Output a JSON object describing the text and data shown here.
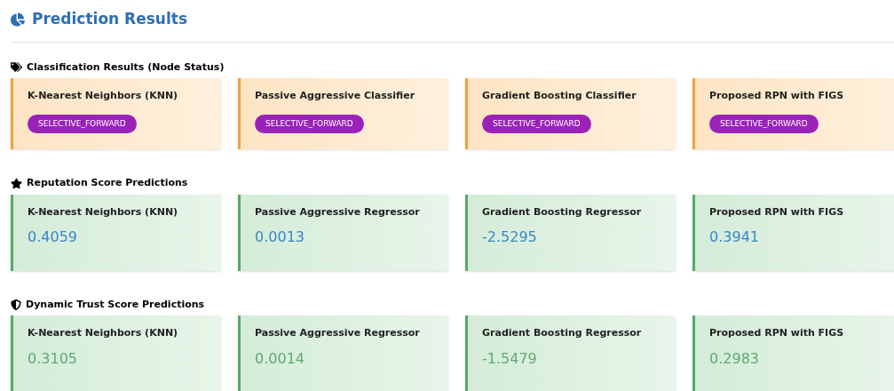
{
  "title": "Prediction Results",
  "sections": [
    {
      "kind": "status",
      "heading": "Classification Results (Node Status)",
      "cards": [
        {
          "model": "K-Nearest Neighbors (KNN)",
          "result": "SELECTIVE_FORWARD"
        },
        {
          "model": "Passive Aggressive Classifier",
          "result": "SELECTIVE_FORWARD"
        },
        {
          "model": "Gradient Boosting Classifier",
          "result": "SELECTIVE_FORWARD"
        },
        {
          "model": "Proposed RPN with FIGS",
          "result": "SELECTIVE_FORWARD"
        }
      ]
    },
    {
      "kind": "score",
      "color": "#3a86c8",
      "heading": "Reputation Score Predictions",
      "cards": [
        {
          "model": "K-Nearest Neighbors (KNN)",
          "result": "0.4059"
        },
        {
          "model": "Passive Aggressive Regressor",
          "result": "0.0013"
        },
        {
          "model": "Gradient Boosting Regressor",
          "result": "-2.5295"
        },
        {
          "model": "Proposed RPN with FIGS",
          "result": "0.3941"
        }
      ]
    },
    {
      "kind": "score",
      "color": "#5fa874",
      "heading": "Dynamic Trust Score Predictions",
      "cards": [
        {
          "model": "K-Nearest Neighbors (KNN)",
          "result": "0.3105"
        },
        {
          "model": "Passive Aggressive Regressor",
          "result": "0.0014"
        },
        {
          "model": "Gradient Boosting Regressor",
          "result": "-1.5479"
        },
        {
          "model": "Proposed RPN with FIGS",
          "result": "0.2983"
        }
      ]
    }
  ]
}
